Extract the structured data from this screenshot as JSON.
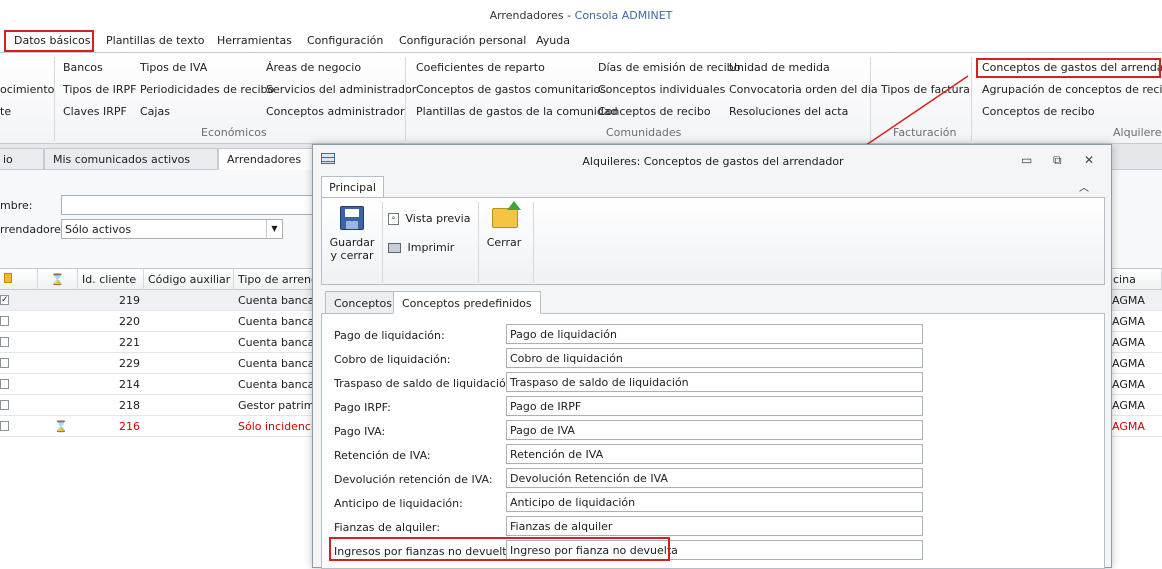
{
  "app": {
    "title": "Arrendadores - ",
    "subtitle": "Consola ADMINET"
  },
  "menu": [
    "Datos básicos",
    "Plantillas de texto",
    "Herramientas",
    "Configuración",
    "Configuración personal",
    "Ayuda"
  ],
  "ribbon": {
    "col0": [
      "ocimiento",
      "te"
    ],
    "col1": [
      "Bancos",
      "Tipos de IRPF",
      "Claves IRPF"
    ],
    "col2": [
      "Tipos de IVA",
      "Periodicidades de recibo",
      "Cajas"
    ],
    "col3": [
      "Áreas de negocio",
      "Servicios del administrador",
      "Conceptos administrador"
    ],
    "col4": [
      "Coeficientes de reparto",
      "Conceptos de gastos comunitarios",
      "Plantillas de gastos de la comunidad"
    ],
    "col5": [
      "Días de emisión de recibo",
      "Conceptos individuales",
      "Conceptos de recibo"
    ],
    "col6": [
      "Unidad de medida",
      "Convocatoria orden del día",
      "Resoluciones del acta"
    ],
    "col7": [
      "Tipos de factura"
    ],
    "col8": [
      "Conceptos de gastos del arrendador",
      "Agrupación de conceptos de recibo",
      "Conceptos de recibo"
    ],
    "groups": {
      "economicos": "Económicos",
      "comunidades": "Comunidades",
      "facturacion": "Facturación",
      "alquileres": "Alquileres"
    }
  },
  "doc_tabs": [
    "io",
    "Mis comunicados activos",
    "Arrendadores"
  ],
  "filter": {
    "name_label": "mbre:",
    "arr_label": "rrendadores:",
    "arr_value": "Sólo activos"
  },
  "grid": {
    "headers": {
      "id": "Id. cliente",
      "aux": "Código auxiliar",
      "tipo": "Tipo de arrenda",
      "right": "cina"
    },
    "rows": [
      {
        "id": "219",
        "tipo": "Cuenta bancaria",
        "right": "AGMA"
      },
      {
        "id": "220",
        "tipo": "Cuenta bancaria",
        "right": "AGMA"
      },
      {
        "id": "221",
        "tipo": "Cuenta bancaria",
        "right": "AGMA"
      },
      {
        "id": "229",
        "tipo": "Cuenta bancaria",
        "right": "AGMA"
      },
      {
        "id": "214",
        "tipo": "Cuenta bancaria",
        "right": "AGMA"
      },
      {
        "id": "218",
        "tipo": "Gestor patrimor",
        "right": "AGMA"
      },
      {
        "id": "216",
        "tipo": "Sólo incidencias",
        "right": "AGMA"
      }
    ]
  },
  "dialog": {
    "title": "Alquileres: Conceptos de gastos del arrendador",
    "ribbon_tab": "Principal",
    "save_line1": "Guardar",
    "save_line2": "y cerrar",
    "preview": "Vista previa",
    "print": "Imprimir",
    "close": "Cerrar",
    "tabs": [
      "Conceptos",
      "Conceptos predefinidos"
    ],
    "fields": [
      {
        "label": "Pago de liquidación:",
        "value": "Pago de liquidación"
      },
      {
        "label": "Cobro de liquidación:",
        "value": "Cobro de liquidación"
      },
      {
        "label": "Traspaso de saldo de liquidación:",
        "value": "Traspaso de saldo de liquidación"
      },
      {
        "label": "Pago IRPF:",
        "value": "Pago de IRPF"
      },
      {
        "label": "Pago IVA:",
        "value": "Pago de IVA"
      },
      {
        "label": "Retención de IVA:",
        "value": "Retención de IVA"
      },
      {
        "label": "Devolución retención de IVA:",
        "value": "Devolución Retención de IVA"
      },
      {
        "label": "Anticipo de liquidación:",
        "value": "Anticipo de liquidación"
      },
      {
        "label": "Fianzas de alquiler:",
        "value": "Fianzas de alquiler"
      },
      {
        "label": "Ingresos por fianzas no devueltas:",
        "value": "Ingreso por fianza no devuelta"
      }
    ]
  },
  "colors": {
    "highlight": "#d62020",
    "link_blue": "#3b6aa0",
    "row_red": "#d40000"
  }
}
